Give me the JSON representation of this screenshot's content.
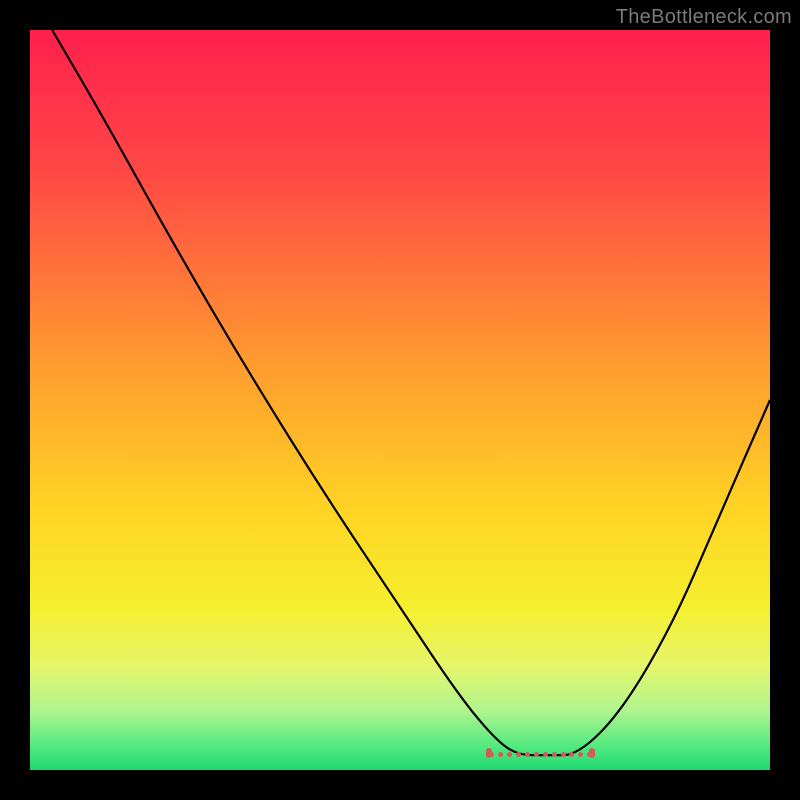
{
  "watermark": "TheBottleneck.com",
  "chart_data": {
    "type": "line",
    "title": "",
    "xlabel": "",
    "ylabel": "",
    "xlim": [
      0,
      100
    ],
    "ylim": [
      0,
      100
    ],
    "grid": false,
    "series": [
      {
        "name": "bottleneck-curve",
        "x": [
          3,
          10,
          20,
          30,
          40,
          50,
          58,
          63,
          66,
          70,
          74,
          80,
          87,
          93,
          100
        ],
        "values": [
          100,
          88,
          70,
          53,
          37,
          22,
          10,
          4,
          2,
          2,
          2,
          8,
          20,
          34,
          50
        ]
      }
    ],
    "flat_zone": {
      "x_start": 62,
      "x_end": 76,
      "y": 2
    },
    "background_gradient_stops": [
      {
        "pct": 0,
        "color": "#ff1f4c"
      },
      {
        "pct": 20,
        "color": "#ff4a45"
      },
      {
        "pct": 45,
        "color": "#ff9b2f"
      },
      {
        "pct": 65,
        "color": "#ffd424"
      },
      {
        "pct": 78,
        "color": "#f5ef2e"
      },
      {
        "pct": 86,
        "color": "#e5f66b"
      },
      {
        "pct": 92,
        "color": "#aef58e"
      },
      {
        "pct": 97,
        "color": "#4ee97f"
      },
      {
        "pct": 100,
        "color": "#1fd871"
      }
    ],
    "curve_color": "#000000",
    "dot_color": "#d45a5a"
  }
}
